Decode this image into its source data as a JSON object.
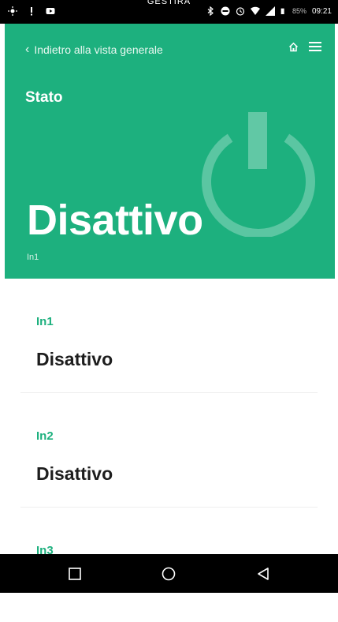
{
  "status_bar": {
    "top_label": "GESTIRA",
    "battery": "85%",
    "time": "09:21",
    "icons": [
      "brightness-icon",
      "alert-icon",
      "video-icon",
      "bluetooth-icon",
      "do-not-disturb-icon",
      "alarm-icon",
      "wifi-icon",
      "signal-icon",
      "battery-icon"
    ]
  },
  "header": {
    "back_label": "Indietro alla vista generale",
    "title": "Stato",
    "state": "Disattivo",
    "state_subtitle": "In1",
    "background_color": "#1db07e",
    "icons": [
      "home-icon",
      "menu-icon",
      "power-icon"
    ]
  },
  "list": {
    "items": [
      {
        "label": "In1",
        "value": "Disattivo"
      },
      {
        "label": "In2",
        "value": "Disattivo"
      },
      {
        "label": "In3",
        "value": ""
      }
    ]
  },
  "nav_bar": {
    "icons": [
      "recent-apps-icon",
      "home-circle-icon",
      "back-triangle-icon"
    ]
  }
}
